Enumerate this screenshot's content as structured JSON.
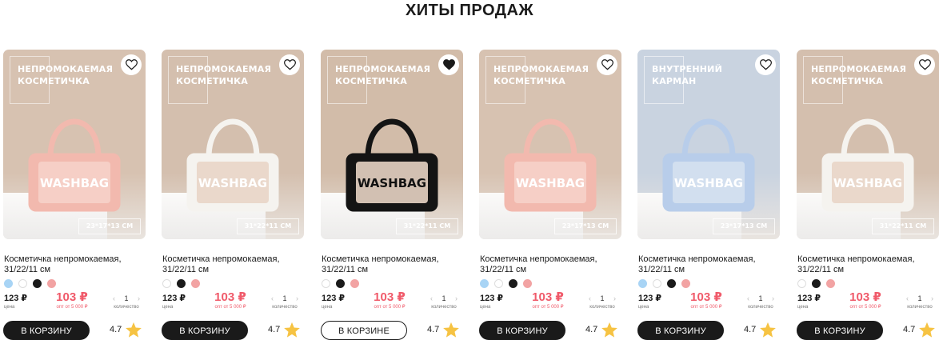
{
  "section_title": "ХИТЫ ПРОДАЖ",
  "colors": {
    "price_accent": "#f05a6a",
    "button_dark": "#1a1a1a",
    "star": "#f6c343"
  },
  "products": [
    {
      "badge_line1": "НЕПРОМОКАЕМАЯ",
      "badge_line2": "КОСМЕТИЧКА",
      "size": "23*17*13 СМ",
      "bag_text": "WASHBAG",
      "favorite": false,
      "bg": "#d7c2b1",
      "bag_color": "#f2b9ae",
      "bag_window": "#f6d2c9",
      "bag_text_color": "#ffffff",
      "name": "Косметичка непромокаемая, 31/22/11 см",
      "swatches": [
        "#a8d4f5",
        "#ffffff",
        "#1a1a1a",
        "#f2a3a3"
      ],
      "price": "123 ₽",
      "price_label": "цена",
      "opt_price": "103 ₽",
      "opt_label": "опт от 5 000 ₽",
      "qty_minus": "‹",
      "qty": "1",
      "qty_plus": "›",
      "qty_label": "количество",
      "button": "В КОРЗИНУ",
      "in_cart": false,
      "rating": "4.7"
    },
    {
      "badge_line1": "НЕПРОМОКАЕМАЯ",
      "badge_line2": "КОСМЕТИЧКА",
      "size": "31*22*11 СМ",
      "bag_text": "WASHBAG",
      "favorite": false,
      "bg": "#d4bfae",
      "bag_color": "#f5f3ef",
      "bag_window": "#e9d5c6",
      "bag_text_color": "#ffffff",
      "name": "Косметичка непромокаемая, 31/22/11 см",
      "swatches": [
        "#ffffff",
        "#1a1a1a",
        "#f2a3a3"
      ],
      "price": "123 ₽",
      "price_label": "цена",
      "opt_price": "103 ₽",
      "opt_label": "опт от 5 000 ₽",
      "qty_minus": "‹",
      "qty": "1",
      "qty_plus": "›",
      "qty_label": "количество",
      "button": "В КОРЗИНУ",
      "in_cart": false,
      "rating": "4.7"
    },
    {
      "badge_line1": "НЕПРОМОКАЕМАЯ",
      "badge_line2": "КОСМЕТИЧКА",
      "size": "31*22*11 СМ",
      "bag_text": "WASHBAG",
      "favorite": true,
      "bg": "#d2bca9",
      "bag_color": "#141414",
      "bag_window": "#e7d3c3",
      "bag_text_color": "#111111",
      "name": "Косметичка непромокаемая, 31/22/11 см",
      "swatches": [
        "#ffffff",
        "#1a1a1a",
        "#f2a3a3"
      ],
      "price": "123 ₽",
      "price_label": "цена",
      "opt_price": "103 ₽",
      "opt_label": "опт от 5 000 ₽",
      "qty_minus": "‹",
      "qty": "1",
      "qty_plus": "›",
      "qty_label": "количество",
      "button": "В КОРЗИНЕ",
      "in_cart": true,
      "rating": "4.7"
    },
    {
      "badge_line1": "НЕПРОМОКАЕМАЯ",
      "badge_line2": "КОСМЕТИЧКА",
      "size": "23*17*13 СМ",
      "bag_text": "WASHBAG",
      "favorite": false,
      "bg": "#d7c2b1",
      "bag_color": "#f2b9ae",
      "bag_window": "#f6d2c9",
      "bag_text_color": "#ffffff",
      "name": "Косметичка непромокаемая, 31/22/11 см",
      "swatches": [
        "#a8d4f5",
        "#ffffff",
        "#1a1a1a",
        "#f2a3a3"
      ],
      "price": "123 ₽",
      "price_label": "цена",
      "opt_price": "103 ₽",
      "opt_label": "опт от 5 000 ₽",
      "qty_minus": "‹",
      "qty": "1",
      "qty_plus": "›",
      "qty_label": "количество",
      "button": "В КОРЗИНУ",
      "in_cart": false,
      "rating": "4.7"
    },
    {
      "badge_line1": "ВНУТРЕННИЙ",
      "badge_line2": "КАРМАН",
      "size": "23*17*13 СМ",
      "bag_text": "WASHBAG",
      "favorite": false,
      "bg": "#c9d3e0",
      "bag_color": "#b8cdea",
      "bag_window": "#d5e1f0",
      "bag_text_color": "#ffffff",
      "name": "Косметичка непромокаемая, 31/22/11 см",
      "swatches": [
        "#a8d4f5",
        "#ffffff",
        "#1a1a1a",
        "#f2a3a3"
      ],
      "price": "123 ₽",
      "price_label": "цена",
      "opt_price": "103 ₽",
      "opt_label": "опт от 5 000 ₽",
      "qty_minus": "‹",
      "qty": "1",
      "qty_plus": "›",
      "qty_label": "количество",
      "button": "В КОРЗИНУ",
      "in_cart": false,
      "rating": "4.7"
    },
    {
      "badge_line1": "НЕПРОМОКАЕМАЯ",
      "badge_line2": "КОСМЕТИЧКА",
      "size": "31*22*11 СМ",
      "bag_text": "WASHBAG",
      "favorite": false,
      "bg": "#d4bfae",
      "bag_color": "#f5f3ef",
      "bag_window": "#e9d5c6",
      "bag_text_color": "#ffffff",
      "name": "Косметичка непромокаемая, 31/22/11 см",
      "swatches": [
        "#ffffff",
        "#1a1a1a",
        "#f2a3a3"
      ],
      "price": "123 ₽",
      "price_label": "цена",
      "opt_price": "103 ₽",
      "opt_label": "опт от 5 000 ₽",
      "qty_minus": "‹",
      "qty": "1",
      "qty_plus": "›",
      "qty_label": "количество",
      "button": "В КОРЗИНУ",
      "in_cart": false,
      "rating": "4.7"
    }
  ]
}
